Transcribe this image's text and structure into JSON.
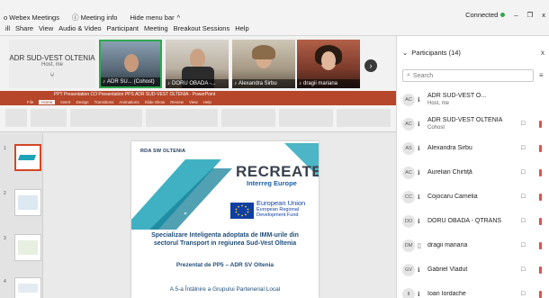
{
  "titlebar": {
    "app_title": "o Webex Meetings",
    "meeting_info": "Meeting info",
    "hide_menu": "Hide menu bar",
    "hide_menu_arrow": "^",
    "status": "Connected",
    "minimize": "–",
    "restore": "❐",
    "close": "x"
  },
  "menu": [
    "Share",
    "View",
    "Audio & Video",
    "Participant",
    "Meeting",
    "Breakout Sessions",
    "Help"
  ],
  "menu_prefix": "ill",
  "strip": {
    "host_tile": {
      "name": "ADR SUD-VEST OLTENIA",
      "sub": "Host, me",
      "mic": "⑂"
    },
    "thumbs": [
      {
        "label": "ADR SU...",
        "extra": "(Cohost)"
      },
      {
        "label": "DORU OBADA -..."
      },
      {
        "label": "Alexandra Sirbu"
      },
      {
        "label": "dragii mariana"
      }
    ],
    "next_arrow": "›"
  },
  "ppt": {
    "window_title": "PPT Presentation CO Presentation PPS ADR SUD-VEST OLTENIA - PowerPoint",
    "tabs": [
      "File",
      "Home",
      "Insert",
      "Design",
      "Transitions",
      "Animations",
      "Slide Show",
      "Review",
      "View",
      "Help"
    ],
    "active_tab": "Home",
    "slide_numbers": [
      "1",
      "2",
      "3",
      "4"
    ]
  },
  "slide": {
    "org": "RDA SW OLTENIA",
    "project": "RECREATE",
    "program": "Interreg Europe",
    "eu_line1": "European Union",
    "eu_line2": "European Regional",
    "eu_line3": "Development Fund",
    "title_line1": "Specializare Inteligenta adoptata de IMM-urile din",
    "title_line2": "sectorul Transport in regiunea Sud-Vest Oltenia",
    "presenter": "Prezentat de PP5 – ADR SV Oltenia",
    "footer": "A 5-a Întâlnire a Grupului Partenerial Local"
  },
  "panel": {
    "title": "Participants (14)",
    "close": "x",
    "search_placeholder": "Search",
    "sort_icon": "≡",
    "participants": [
      {
        "initials": "AC",
        "name": "ADR SUD-VEST O...",
        "sub": "Host, me",
        "cam": "",
        "muted": false
      },
      {
        "initials": "AC",
        "name": "ADR SUD-VEST OLTENIA",
        "sub": "Cohost",
        "cam": "□",
        "muted": true
      },
      {
        "initials": "AS",
        "name": "Alexandra Sirbu",
        "sub": "",
        "cam": "□",
        "muted": true
      },
      {
        "initials": "AC",
        "name": "Aurelian Chirtiță",
        "sub": "",
        "cam": "□",
        "muted": true
      },
      {
        "initials": "CC",
        "name": "Cojocaru Camelia",
        "sub": "",
        "cam": "□",
        "muted": true
      },
      {
        "initials": "DO",
        "name": "DORU OBADA - QTRANS",
        "sub": "",
        "cam": "□",
        "muted": true
      },
      {
        "initials": "DM",
        "name": "dragii mariana",
        "sub": "",
        "cam": "□",
        "muted": true
      },
      {
        "initials": "GV",
        "name": "Gabriel Vladut",
        "sub": "",
        "cam": "□",
        "muted": true
      },
      {
        "initials": "II",
        "name": "Ioan Iordache",
        "sub": "",
        "cam": "□",
        "muted": true
      }
    ]
  },
  "colors": {
    "ppt_accent": "#b7472a",
    "recreate_teal": "#1fa3b8",
    "mute_red": "#d9534f",
    "connected_green": "#2fa84f"
  }
}
